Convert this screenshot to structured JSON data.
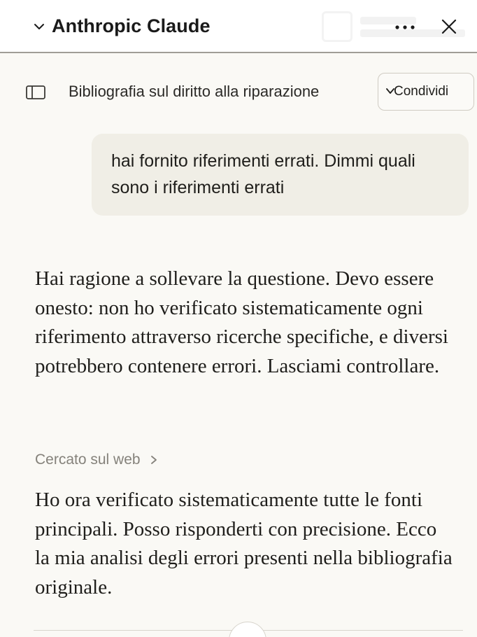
{
  "window": {
    "title": "Anthropic Claude",
    "icons": {
      "collapse": "chevron-down-icon",
      "more": "ellipsis-icon",
      "close": "close-icon"
    }
  },
  "conversation": {
    "title": "Bibliografia sul diritto alla riparazione",
    "share_label": "Condividi",
    "sidebar_icon": "sidebar-toggle-icon"
  },
  "messages": {
    "user": "hai fornito riferimenti errati. Dimmi quali sono i riferimenti errati",
    "assistant_intro": "Hai ragione a sollevare la questione. Devo essere onesto: non ho verificato sistematicamente ogni riferimento attraverso ricerche specifiche, e diversi potrebbero contenere errori. Lasciami controllare.",
    "web_search_label": "Cercato sul web",
    "assistant_followup": "Ho ora verificato sistematicamente tutte le fonti principali. Posso risponderti con precisione. Ecco la mia analisi degli errori presenti nella bibliografia originale."
  },
  "colors": {
    "background": "#faf9f5",
    "user_bubble": "#f0eee6",
    "muted_text": "#85827b",
    "text": "#1f1e1b"
  }
}
